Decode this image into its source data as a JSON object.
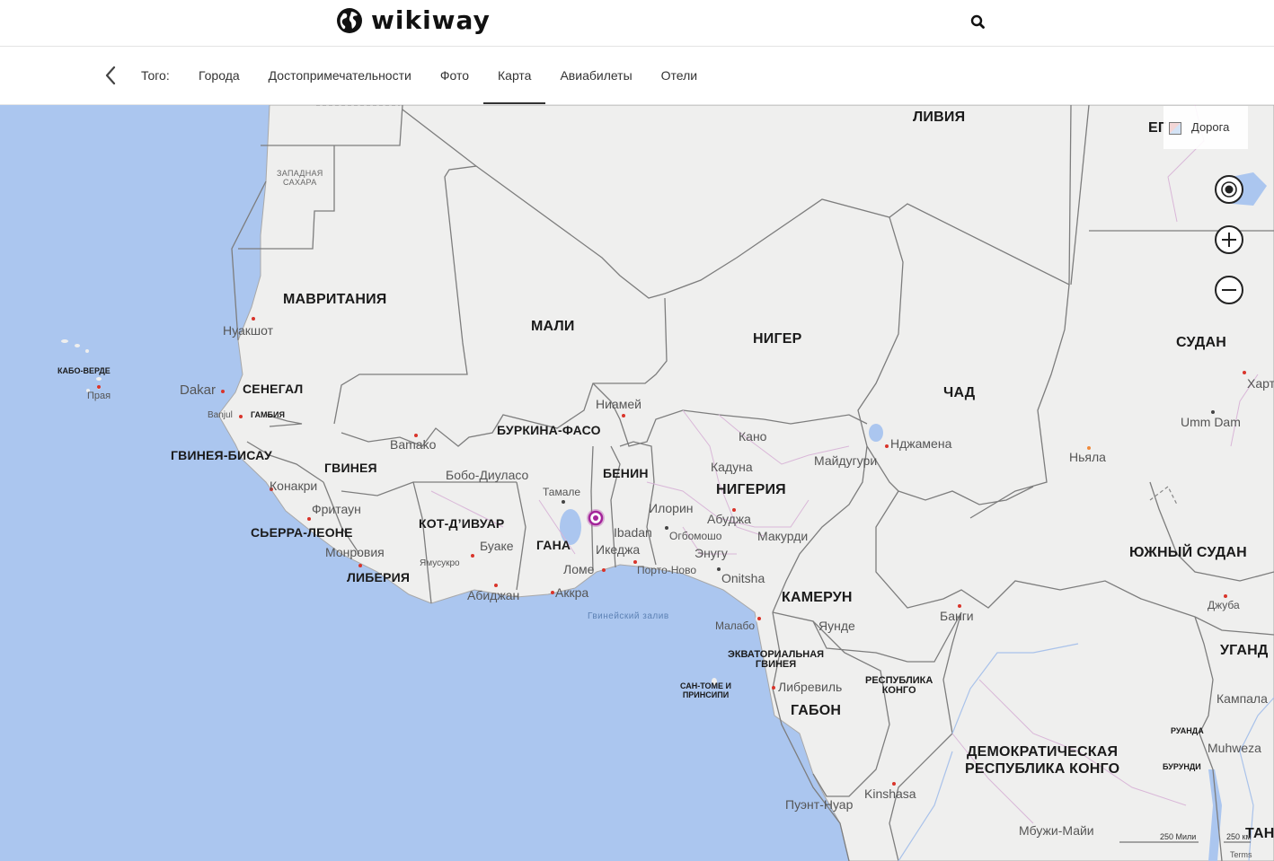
{
  "header": {
    "logo_text": "wikiway",
    "logo_icon": "globe-icon",
    "search_icon": "search-icon"
  },
  "nav": {
    "back_icon": "chevron-left-icon",
    "section_label": "Того:",
    "tabs": [
      {
        "label": "Города",
        "active": false
      },
      {
        "label": "Достопримечательности",
        "active": false
      },
      {
        "label": "Фото",
        "active": false
      },
      {
        "label": "Карта",
        "active": true
      },
      {
        "label": "Авиабилеты",
        "active": false
      },
      {
        "label": "Отели",
        "active": false
      }
    ]
  },
  "map": {
    "style_label": "Дорога",
    "style_partial_label": "ЕГ",
    "controls": {
      "locate_icon": "target-icon",
      "zoom_in_icon": "plus-icon",
      "zoom_out_icon": "minus-icon"
    },
    "scale_miles": "250 Мили",
    "scale_km": "250 км",
    "terms": "Terms",
    "countries": {
      "libya": "ЛИВИЯ",
      "mauritania": "МАВРИТАНИЯ",
      "mali": "МАЛИ",
      "niger": "НИГЕР",
      "chad": "ЧАД",
      "sudan": "СУДАН",
      "senegal": "СЕНЕГАЛ",
      "gambia": "ГАМБИЯ",
      "guinea_bissau": "ГВИНЕЯ-БИСАУ",
      "guinea": "ГВИНЕЯ",
      "sierra_leone": "СЬЕРРА-ЛЕОНЕ",
      "liberia": "ЛИБЕРИЯ",
      "cote_divoire": "КОТ-Д’ИВУАР",
      "burkina_faso": "БУРКИНА-ФАСО",
      "ghana": "ГАНА",
      "benin": "БЕНИН",
      "nigeria": "НИГЕРИЯ",
      "cameroon": "КАМЕРУН",
      "south_sudan": "ЮЖНЫЙ СУДАН",
      "uganda": "УГАНД",
      "eq_guinea_1": "ЭКВАТОРИАЛЬНАЯ",
      "eq_guinea_2": "ГВИНЕЯ",
      "sao_tome_1": "САН-ТОМЕ И",
      "sao_tome_2": "ПРИНСИПИ",
      "congo_1": "РЕСПУБЛИКА",
      "congo_2": "КОНГО",
      "gabon": "ГАБОН",
      "drc_1": "ДЕМОКРАТИЧЕСКАЯ",
      "drc_2": "РЕСПУБЛИКА КОНГО",
      "rwanda": "РУАНДА",
      "burundi": "БУРУНДИ",
      "cabo_verde": "КАБО-ВЕРДЕ",
      "tanzania_partial": "ТАН",
      "w_sahara_1": "ЗАПАДНАЯ",
      "w_sahara_2": "САХАРА"
    },
    "cities": {
      "nouakchott": "Нуакшот",
      "praia": "Прая",
      "dakar": "Dakar",
      "banjul": "Banjul",
      "bamako": "Bamako",
      "conakry": "Конакри",
      "freetown": "Фритаун",
      "monrovia": "Монровия",
      "yamoussoukro": "Ямусукро",
      "bouake": "Буаке",
      "abidjan": "Абиджан",
      "bobo": "Бобо-Диуласо",
      "niamey": "Ниамей",
      "tamale": "Тамале",
      "lome": "Ломе",
      "accra": "Аккра",
      "ibadan": "Ibadan",
      "ikeja": "Икеджа",
      "porto_novo": "Порто-Ново",
      "ilorin": "Илорин",
      "ogbomosho": "Огбомошо",
      "abuja": "Абуджа",
      "kano": "Кано",
      "kaduna": "Кадуна",
      "maiduguri": "Майдугури",
      "makurdi": "Макурди",
      "enugu": "Энугу",
      "onitsha": "Onitsha",
      "ndjamena": "Нджамена",
      "nyala": "Ньяла",
      "umm_dam": "Umm Dam",
      "khartoum_partial": "Харт",
      "malabo": "Малабо",
      "yaounde": "Яунде",
      "bangui": "Банги",
      "libreville": "Либревиль",
      "pointe_noire": "Пуэнт-Нуар",
      "kinshasa": "Kinshasa",
      "mbuji_mayi": "Мбужи-Майи",
      "juba": "Джуба",
      "kampala": "Кампала",
      "muhweza": "Muhweza",
      "gulf_of_guinea": "Гвинейский залив"
    }
  }
}
